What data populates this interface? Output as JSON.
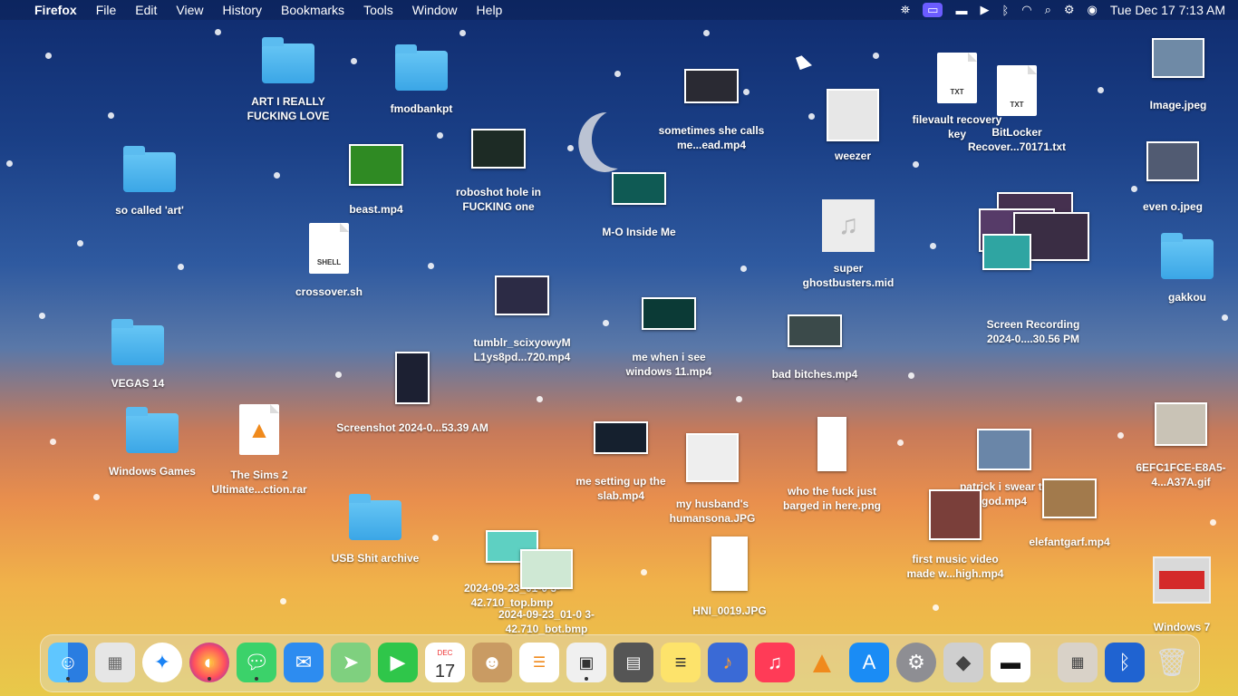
{
  "menubar": {
    "app": "Firefox",
    "menus": [
      "File",
      "Edit",
      "View",
      "History",
      "Bookmarks",
      "Tools",
      "Window",
      "Help"
    ],
    "clock": "Tue Dec 17  7:13 AM"
  },
  "desktop": {
    "items": [
      {
        "label": "ART I REALLY FUCKING LOVE",
        "type": "folder"
      },
      {
        "label": "fmodbankpt",
        "type": "folder"
      },
      {
        "label": "so called 'art'",
        "type": "folder"
      },
      {
        "label": "beast.mp4",
        "type": "video"
      },
      {
        "label": "roboshot hole in FUCKING one",
        "type": "video"
      },
      {
        "label": "sometimes she calls me...ead.mp4",
        "type": "video"
      },
      {
        "label": "M-O Inside Me",
        "type": "video"
      },
      {
        "label": "weezer",
        "type": "image"
      },
      {
        "label": "filevault recovery key",
        "type": "txt",
        "badge": "TXT"
      },
      {
        "label": "BitLocker Recover...70171.txt",
        "type": "txt",
        "badge": "TXT"
      },
      {
        "label": "Image.jpeg",
        "type": "image"
      },
      {
        "label": "even o.jpeg",
        "type": "image"
      },
      {
        "label": "crossover.sh",
        "type": "shell",
        "badge": "SHELL"
      },
      {
        "label": "super ghostbusters.mid",
        "type": "audio"
      },
      {
        "label": "gakkou",
        "type": "folder"
      },
      {
        "label": "VEGAS 14",
        "type": "folder"
      },
      {
        "label": "tumblr_scixyowyM L1ys8pd...720.mp4",
        "type": "video"
      },
      {
        "label": "me when i see windows 11.mp4",
        "type": "video"
      },
      {
        "label": "bad bitches.mp4",
        "type": "video"
      },
      {
        "label": "Screenshot 2024-0...53.39 AM",
        "type": "image"
      },
      {
        "label": "Windows Games",
        "type": "folder"
      },
      {
        "label": "The Sims 2 Ultimate...ction.rar",
        "type": "archive"
      },
      {
        "label": "me setting up the slab.mp4",
        "type": "video"
      },
      {
        "label": "my husband's humansona.JPG",
        "type": "image"
      },
      {
        "label": "who the fuck just barged in here.png",
        "type": "image"
      },
      {
        "label": "patrick i swear to god.mp4",
        "type": "video"
      },
      {
        "label": "6EFC1FCE-E8A5-4...A37A.gif",
        "type": "image"
      },
      {
        "label": "USB Shit archive",
        "type": "folder"
      },
      {
        "label": "2024-09-23_01-0 3-42.710_top.bmp",
        "type": "image"
      },
      {
        "label": "2024-09-23_01-0 3-42.710_bot.bmp",
        "type": "image"
      },
      {
        "label": "HNI_0019.JPG",
        "type": "image"
      },
      {
        "label": "first music video made w...high.mp4",
        "type": "video"
      },
      {
        "label": "elefantgarf.mp4",
        "type": "video"
      },
      {
        "label": "Windows 7",
        "type": "parallels"
      },
      {
        "label": "Screen Recording 2024-0....30.56 PM",
        "type": "stack"
      }
    ]
  },
  "dock": {
    "apps": [
      "finder-icon",
      "launchpad-icon",
      "safari-icon",
      "firefox-icon",
      "messages-icon",
      "mail-icon",
      "maps-icon",
      "facetime-icon",
      "calendar-icon",
      "contacts-icon",
      "reminders-icon",
      "pixel-app-icon",
      "calculator-icon",
      "notes-icon",
      "audacity-icon",
      "music-icon",
      "vlc-icon",
      "app-store-icon",
      "system-settings-icon",
      "roblox-icon",
      "controller-icon",
      "downloads-stack-icon",
      "bluetooth-icon",
      "trash-icon"
    ],
    "calendar_month": "DEC",
    "calendar_day": "17"
  },
  "colors": {
    "folder": "#4bb3ec",
    "menu_active": "#6b5cff"
  }
}
